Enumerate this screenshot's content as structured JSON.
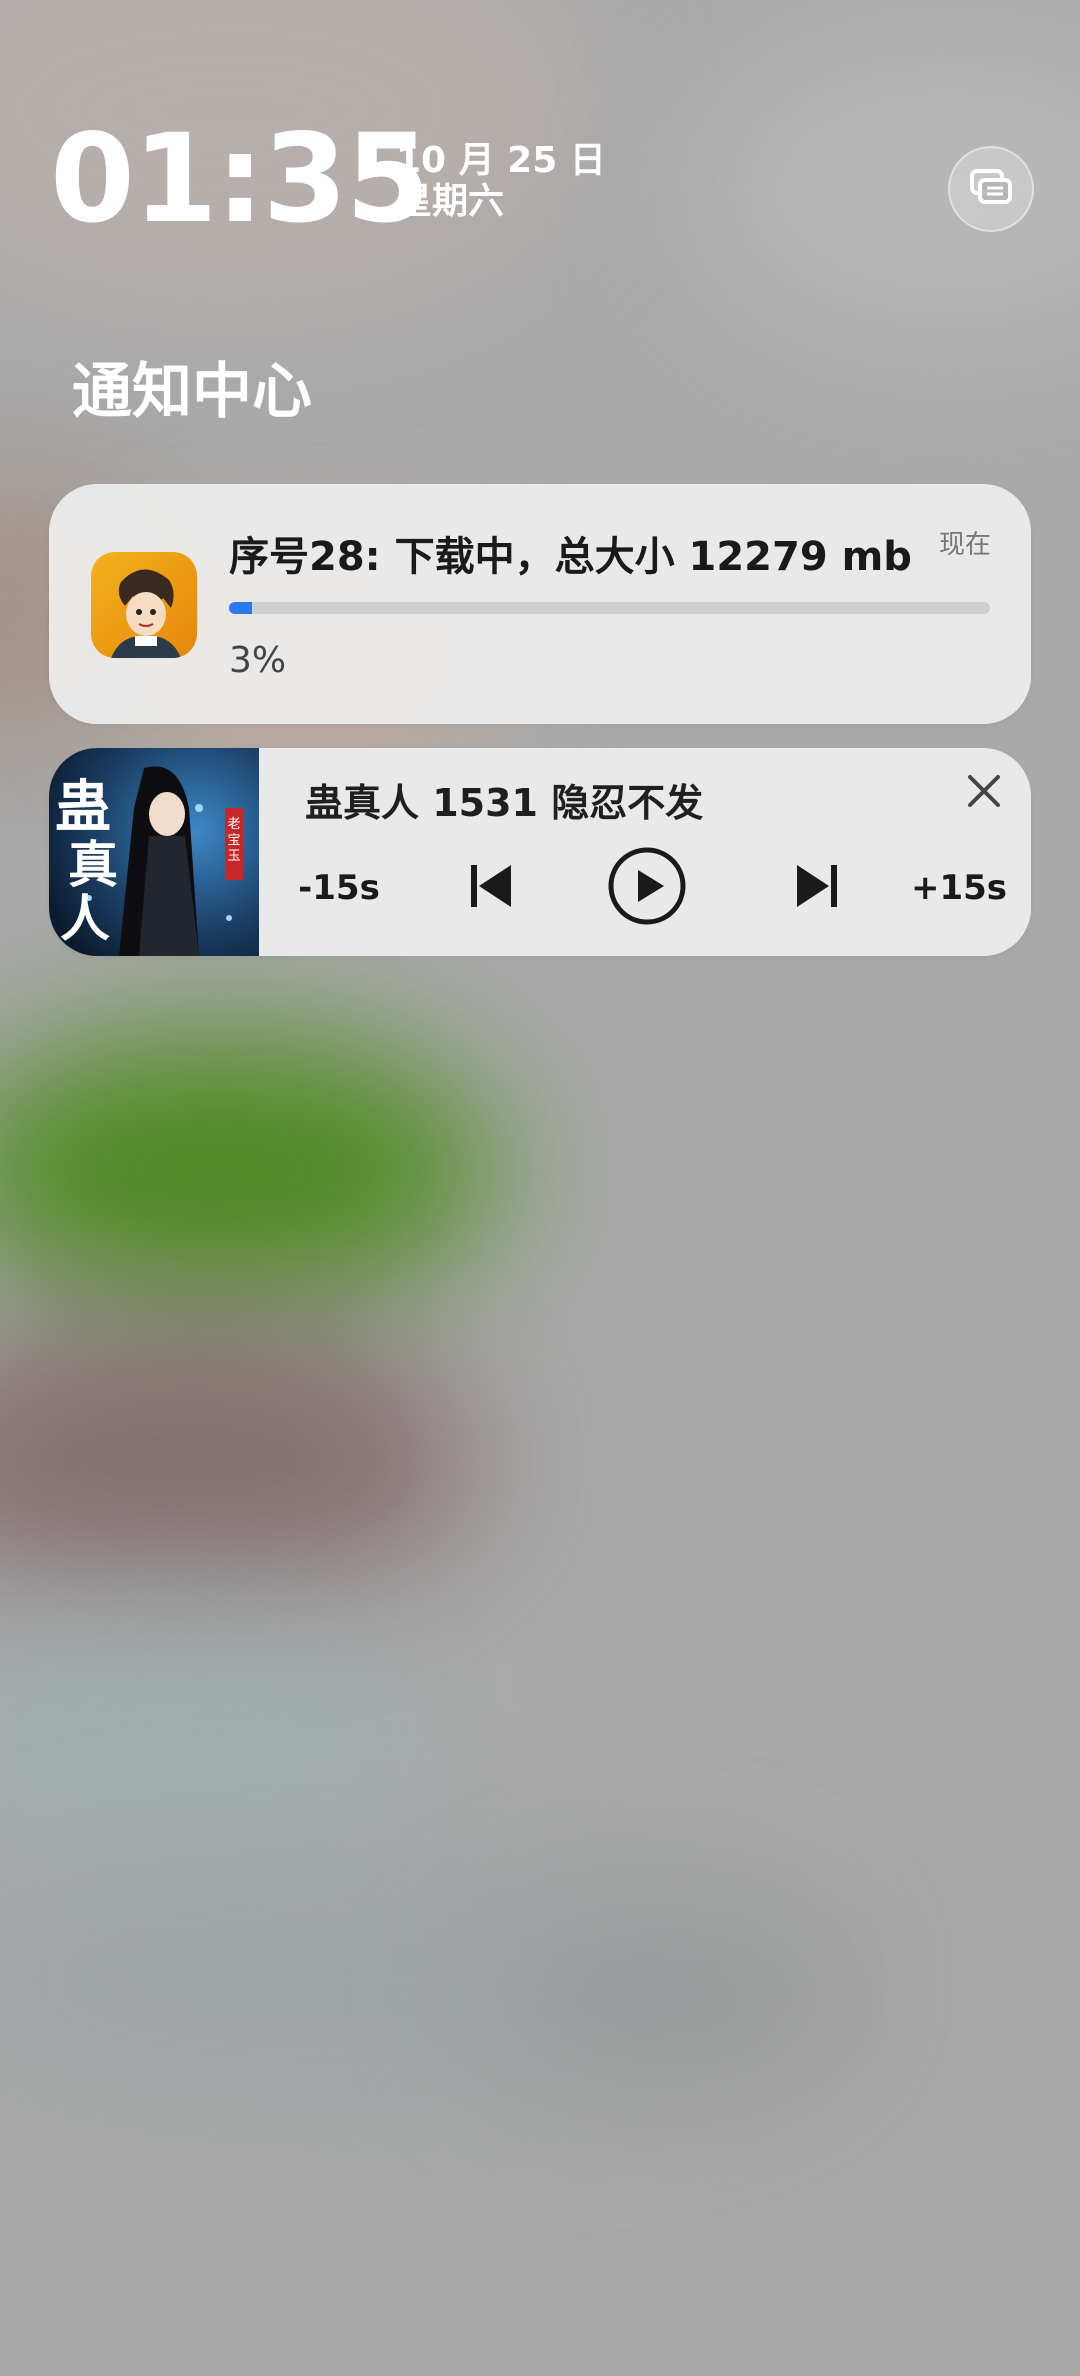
{
  "status": {
    "time": "01:35",
    "date": "10 月 25 日",
    "weekday": "星期六"
  },
  "notification_center": {
    "title": "通知中心"
  },
  "download_notification": {
    "title": "序号28: 下载中，总大小 12279 mb",
    "time": "现在",
    "progress_percent": 3,
    "progress_text": "3%"
  },
  "media_player": {
    "track_title": "蛊真人 1531 隐忍不发",
    "rewind_label": "-15s",
    "forward_label": "+15s",
    "icons": {
      "previous": "skip-previous-icon",
      "play": "play-circle-icon",
      "next": "skip-next-icon",
      "close": "close-icon"
    }
  },
  "colors": {
    "accent": "#2a78f0",
    "card_bg": "#eeeeee",
    "backdrop": "#a9a9a9"
  }
}
